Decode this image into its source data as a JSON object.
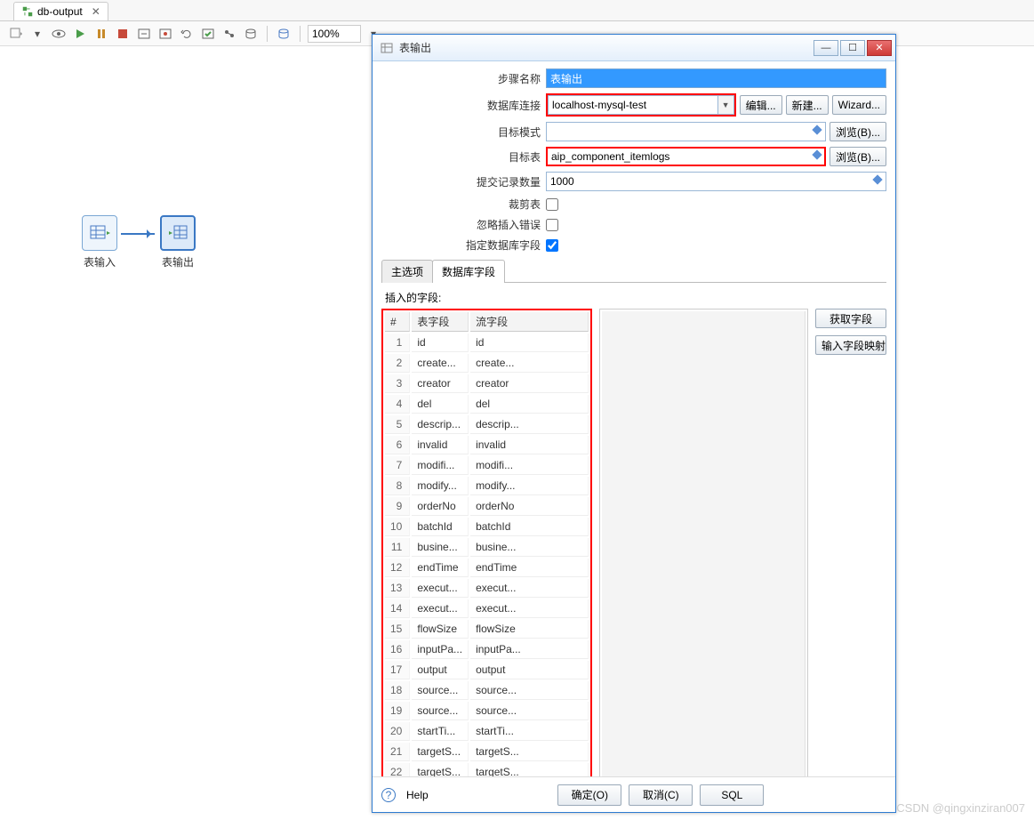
{
  "editorTab": {
    "title": "db-output",
    "closeGlyph": "✕"
  },
  "toolbar": {
    "zoom": "100%"
  },
  "canvas": {
    "nodes": [
      {
        "id": "n1",
        "label": "表输入"
      },
      {
        "id": "n2",
        "label": "表输出"
      }
    ]
  },
  "dialog": {
    "title": "表输出",
    "labels": {
      "stepName": "步骤名称",
      "conn": "数据库连接",
      "schema": "目标模式",
      "table": "目标表",
      "commit": "提交记录数量",
      "truncate": "裁剪表",
      "ignore": "忽略插入错误",
      "specify": "指定数据库字段",
      "edit": "编辑...",
      "new": "新建...",
      "wizard": "Wizard...",
      "browse": "浏览(B)...",
      "tabMain": "主选项",
      "tabFields": "数据库字段",
      "insertFields": "插入的字段:",
      "colNum": "#",
      "colTable": "表字段",
      "colStream": "流字段",
      "btnGetFields": "获取字段",
      "btnMapping": "输入字段映射",
      "help": "Help",
      "ok": "确定(O)",
      "cancel": "取消(C)",
      "sql": "SQL"
    },
    "values": {
      "stepName": "表输出",
      "conn": "localhost-mysql-test",
      "schema": "",
      "table": "aip_component_itemlogs",
      "commit": "1000",
      "truncate": false,
      "ignore": false,
      "specify": true
    },
    "fields": [
      {
        "n": 1,
        "t": "id",
        "s": "id"
      },
      {
        "n": 2,
        "t": "create...",
        "s": "create..."
      },
      {
        "n": 3,
        "t": "creator",
        "s": "creator"
      },
      {
        "n": 4,
        "t": "del",
        "s": "del"
      },
      {
        "n": 5,
        "t": "descrip...",
        "s": "descrip..."
      },
      {
        "n": 6,
        "t": "invalid",
        "s": "invalid"
      },
      {
        "n": 7,
        "t": "modifi...",
        "s": "modifi..."
      },
      {
        "n": 8,
        "t": "modify...",
        "s": "modify..."
      },
      {
        "n": 9,
        "t": "orderNo",
        "s": "orderNo"
      },
      {
        "n": 10,
        "t": "batchId",
        "s": "batchId"
      },
      {
        "n": 11,
        "t": "busine...",
        "s": "busine..."
      },
      {
        "n": 12,
        "t": "endTime",
        "s": "endTime"
      },
      {
        "n": 13,
        "t": "execut...",
        "s": "execut..."
      },
      {
        "n": 14,
        "t": "execut...",
        "s": "execut..."
      },
      {
        "n": 15,
        "t": "flowSize",
        "s": "flowSize"
      },
      {
        "n": 16,
        "t": "inputPa...",
        "s": "inputPa..."
      },
      {
        "n": 17,
        "t": "output",
        "s": "output"
      },
      {
        "n": 18,
        "t": "source...",
        "s": "source..."
      },
      {
        "n": 19,
        "t": "source...",
        "s": "source..."
      },
      {
        "n": 20,
        "t": "startTi...",
        "s": "startTi..."
      },
      {
        "n": 21,
        "t": "targetS...",
        "s": "targetS..."
      },
      {
        "n": 22,
        "t": "targetS...",
        "s": "targetS..."
      }
    ]
  },
  "watermark": "CSDN @qingxinziran007"
}
